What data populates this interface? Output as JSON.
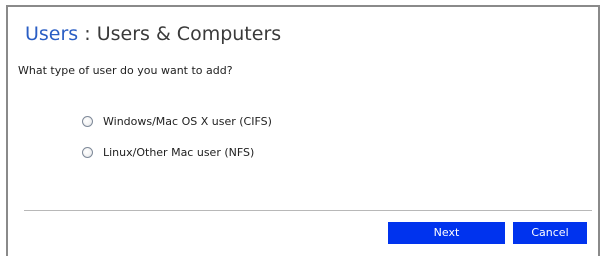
{
  "header": {
    "breadcrumb_link": "Users",
    "separator": " : ",
    "title": "Users & Computers"
  },
  "form": {
    "question": "What type of user do you want to add?",
    "options": [
      {
        "label": "Windows/Mac OS X user (CIFS)",
        "selected": false
      },
      {
        "label": "Linux/Other Mac user (NFS)",
        "selected": false
      }
    ]
  },
  "buttons": {
    "next": "Next",
    "cancel": "Cancel"
  },
  "colors": {
    "accent": "#0033ee",
    "link": "#2a5ec4"
  }
}
